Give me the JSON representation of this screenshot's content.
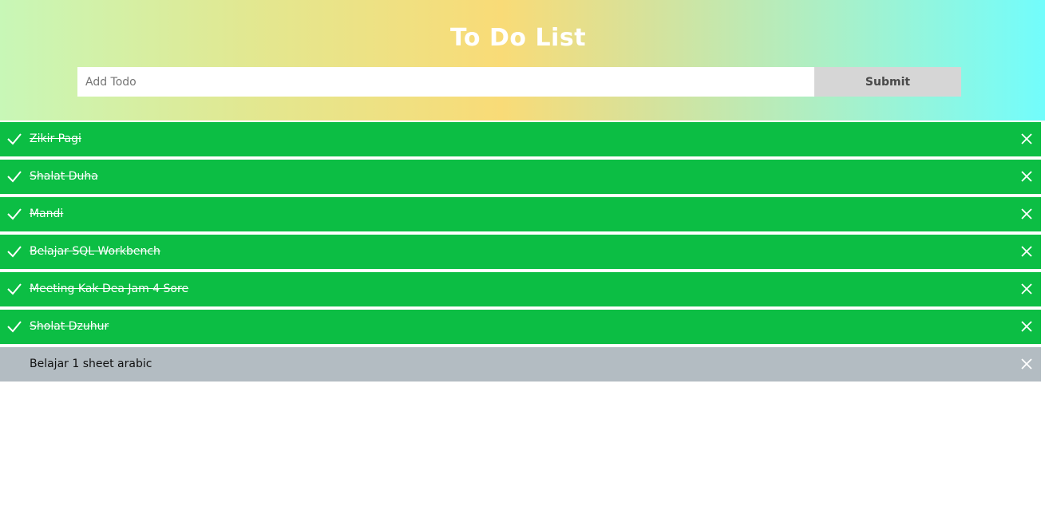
{
  "header": {
    "title": "To Do List",
    "input_placeholder": "Add Todo",
    "input_value": "",
    "submit_label": "Submit"
  },
  "todos": [
    {
      "label": "Zikir Pagi",
      "completed": true
    },
    {
      "label": "Shalat Duha",
      "completed": true
    },
    {
      "label": "Mandi",
      "completed": true
    },
    {
      "label": "Belajar SQL Workbench",
      "completed": true
    },
    {
      "label": "Meeting Kak Dea Jam 4 Sore",
      "completed": true
    },
    {
      "label": "Sholat Dzuhur",
      "completed": true
    },
    {
      "label": "Belajar 1 sheet arabic",
      "completed": false
    }
  ],
  "icons": {
    "check": "check-icon",
    "close": "close-icon"
  },
  "colors": {
    "completed_bg": "#0cbe44",
    "pending_bg": "#b3bcc2",
    "submit_bg": "#d6d6d6"
  }
}
